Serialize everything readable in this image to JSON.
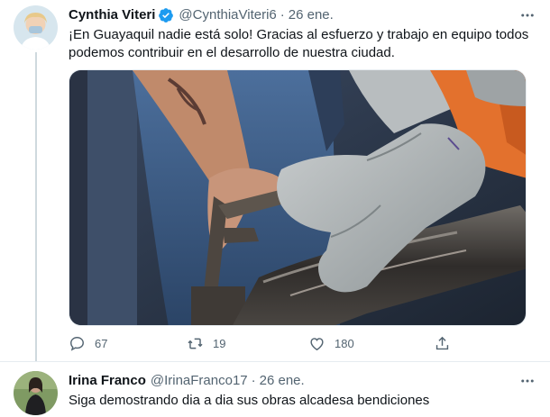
{
  "tweet": {
    "author_name": "Cynthia Viteri",
    "author_handle": "@CynthiaViteri6",
    "separator": "·",
    "date": "26 ene.",
    "text": "¡En Guayaquil nadie está solo! Gracias al esfuerzo y trabajo en equipo todos podemos contribuir en el desarrollo de nuestra ciudad.",
    "reply_count": "67",
    "retweet_count": "19",
    "like_count": "180"
  },
  "reply": {
    "author_name": "Irina Franco",
    "author_handle": "@IrinaFranco17",
    "separator": "·",
    "date": "26 ene.",
    "text": "Siga demostrando dia a dia sus obras alcadesa bendiciones"
  },
  "icons": {
    "verified": "verified-badge-icon",
    "more": "more-horizontal-icon",
    "reply": "reply-bubble-icon",
    "retweet": "retweet-icon",
    "like": "heart-icon",
    "share": "share-icon"
  },
  "colors": {
    "accent": "#1d9bf0",
    "secondary_text": "#536471",
    "primary_text": "#0f1419",
    "divider": "#e6ecf0"
  }
}
